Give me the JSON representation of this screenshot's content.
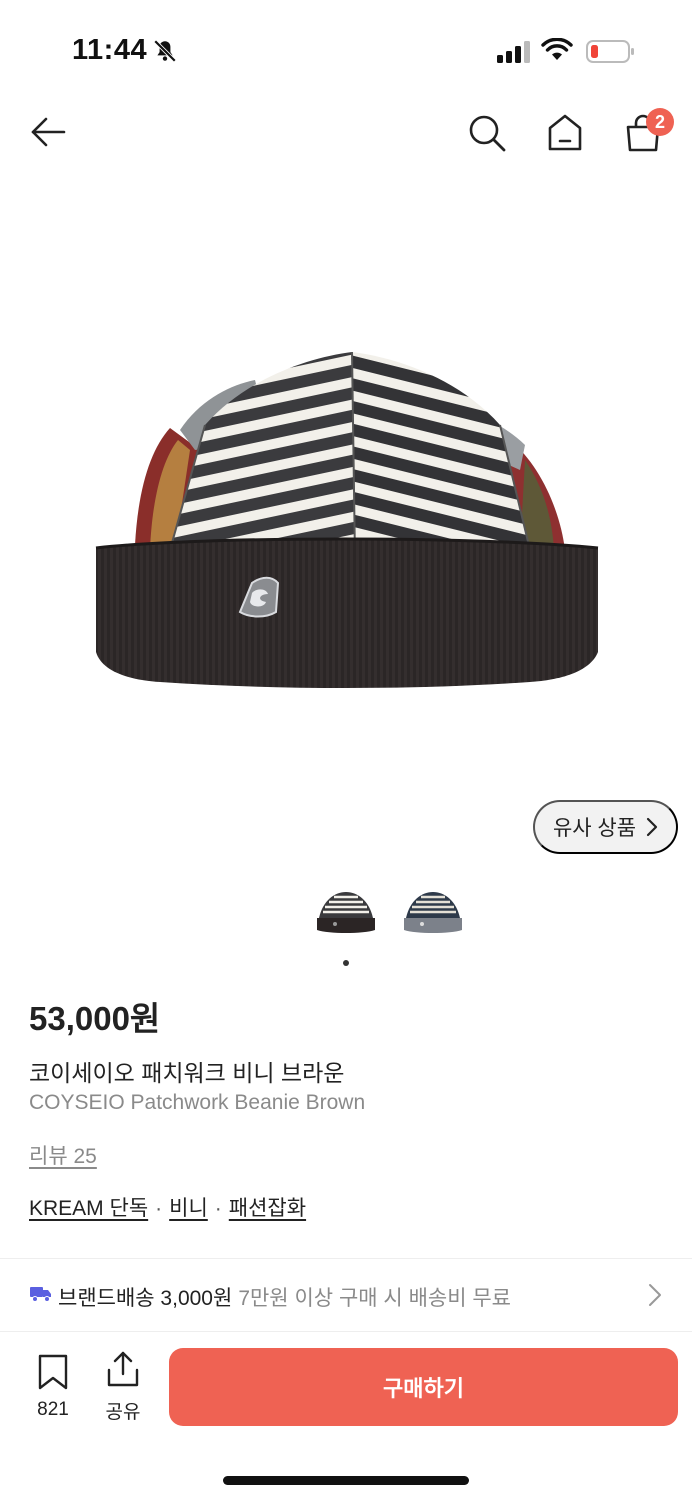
{
  "status_bar": {
    "time": "11:44",
    "icons": [
      "bell-slash-icon",
      "signal-icon",
      "wifi-icon",
      "battery-low-icon"
    ],
    "battery_color": "#f04438"
  },
  "nav": {
    "icons": [
      "back-arrow-icon",
      "search-icon",
      "home-icon",
      "shopping-bag-icon"
    ],
    "cart_count": "2",
    "badge_color": "#ef6253"
  },
  "product": {
    "image": "beanie-image",
    "similar_label": "유사 상품",
    "thumbnails": [
      "thumbnail-brown",
      "thumbnail-gray"
    ],
    "carousel_active_index": 0,
    "price": "53,000원",
    "name_ko": "코이세이오 패치워크 비니 브라운",
    "name_en": "COYSEIO Patchwork Beanie Brown",
    "review_link": "리뷰 25",
    "tags": [
      "KREAM 단독",
      "비니",
      "패션잡화"
    ],
    "tag_separator": "·"
  },
  "shipping": {
    "icon": "truck-icon",
    "label": "브랜드배송 3,000원",
    "note": "7만원 이상 구매 시 배송비 무료",
    "icon_color": "#5a5fe0"
  },
  "bottom_bar": {
    "wish_count": "821",
    "share_label": "공유",
    "buy_label": "구매하기",
    "accent": "#ef6253"
  }
}
